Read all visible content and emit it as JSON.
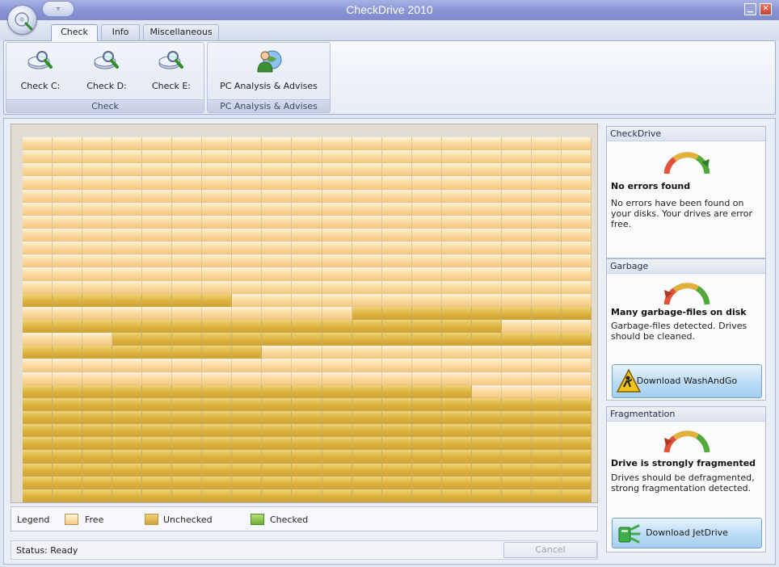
{
  "window": {
    "title": "CheckDrive 2010",
    "qat_label": "▿",
    "minimize_label": "▁",
    "close_label": "✕"
  },
  "tabs": [
    "Check",
    "Info",
    "Miscellaneous"
  ],
  "active_tab": "Check",
  "ribbon": {
    "groups": [
      {
        "label": "Check",
        "buttons": [
          {
            "label": "Check C:",
            "icon": "drive-magnifier-icon"
          },
          {
            "label": "Check D:",
            "icon": "drive-magnifier-icon"
          },
          {
            "label": "Check E:",
            "icon": "drive-magnifier-icon"
          }
        ]
      },
      {
        "label": "PC Analysis & Advises",
        "buttons": [
          {
            "label": "PC Analysis & Advises",
            "icon": "person-globe-icon"
          }
        ]
      }
    ]
  },
  "disk_map": {
    "columns": 19,
    "rows": 28,
    "colors": {
      "free": "#fce0ab",
      "unchecked": "#dcb33d",
      "checked": "#6fae36"
    },
    "row_fill_states": [
      "FFFFFFFFFFFFFFFFFFF",
      "FFFFFFFFFFFFFFFFFFF",
      "FFFFFFFFFFFFFFFFFFF",
      "FFFFFFFFFFFFFFFFFFF",
      "FFFFFFFFFFFFFFFFFFF",
      "FFFFFFFFFFFFFFFFFFF",
      "FFFFFFFFFFFFFFFFFFF",
      "FFFFFFFFFFFFFFFFFFF",
      "FFFFFFFFFFFFFFFFFFF",
      "FFFFFFFFFFFFFFFFFFF",
      "FFFFFFFFFFFFFFFFFFF",
      "FFFFFFFFFFFFFFFFFFF",
      "UUUUUUUFFFFFFFFFFFF",
      "FFFFFFFFFFFUUUUUUUU",
      "UUUUUUUUUUUUUUUUFFF",
      "FFFUUUUUUUUUUUUUUUU",
      "UUUUUUUUFFFFFFFFFFF",
      "FFFFFFFFFFFFFFFFFFF",
      "FFFFFFFFFFFFFFFFFFF",
      "UUUUUUUUUUUUUUUFFFF",
      "UUUUUUUUUUUUUUUUUUU",
      "UUUUUUUUUUUUUUUUUUU",
      "UUUUUUUUUUUUUUUUUUU",
      "UUUUUUUUUUUUUUUUUUU",
      "UUUUUUUUUUUUUUUUUUU",
      "UUUUUUUUUUUUUUUUUUU",
      "UUUUUUUUUUUUUUUUUUU",
      "UUUUUUUUUUUUUUUUUUU"
    ]
  },
  "legend": {
    "title": "Legend",
    "items": [
      {
        "label": "Free",
        "color": "#fce0ab"
      },
      {
        "label": "Unchecked",
        "color": "#dcb33d"
      },
      {
        "label": "Checked",
        "color": "#6fae36"
      }
    ]
  },
  "status": {
    "text": "Status: Ready",
    "cancel_label": "Cancel"
  },
  "panels": {
    "checkdrive": {
      "header": "CheckDrive",
      "title": "No errors found",
      "description": "No errors have been found on your disks. Your drives are error free.",
      "gauge_level": "good"
    },
    "garbage": {
      "header": "Garbage",
      "title": "Many garbage-files on disk",
      "description": "Garbage-files detected. Drives should be cleaned.",
      "gauge_level": "bad",
      "button_label": "Download WashAndGo",
      "button_icon": "warning-cleaner-icon"
    },
    "fragmentation": {
      "header": "Fragmentation",
      "title": "Drive is strongly fragmented",
      "description": "Drives should be defragmented, strong fragmentation detected.",
      "gauge_level": "bad",
      "button_label": "Download JetDrive",
      "button_icon": "jetdrive-icon"
    }
  }
}
